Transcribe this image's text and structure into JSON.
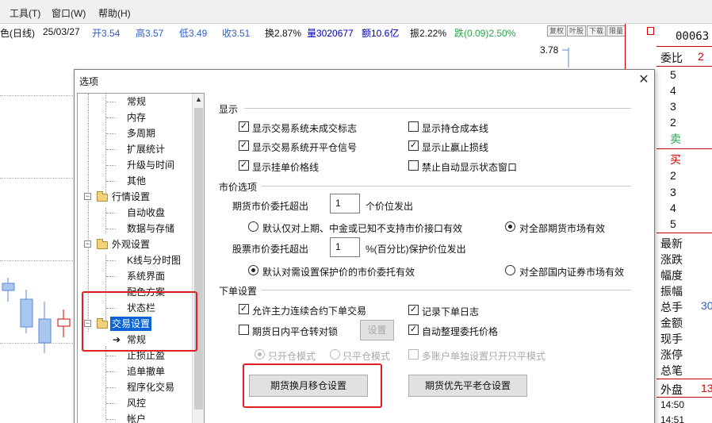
{
  "menubar": {
    "items": [
      "工具(T)",
      "窗口(W)",
      "帮助(H)"
    ]
  },
  "quote": {
    "prefix": "色(日线)",
    "date": "25/03/27",
    "open": "开3.54",
    "high": "高3.57",
    "low": "低3.49",
    "close": "收3.51",
    "turnover": "换2.87%",
    "volume": "量3020677",
    "amount": "额10.6亿",
    "amplitude": "振2.22%",
    "change": "跌(0.09)2.50%",
    "buttons": [
      "复权",
      "叶股",
      "下载",
      "限量"
    ]
  },
  "chart": {
    "price_label": "3.78"
  },
  "right_panel": {
    "code": "00063",
    "commission_label": "委比",
    "commission_value": "2",
    "sell_levels": [
      "5",
      "4",
      "3",
      "2"
    ],
    "sell_label": "卖",
    "buy_label": "买",
    "buy_levels": [
      "2",
      "3",
      "4",
      "5"
    ],
    "stats": [
      "最新",
      "涨跌",
      "幅度",
      "振幅",
      "总手",
      "金额",
      "现手",
      "涨停",
      "总笔"
    ],
    "total_hands_value": "30",
    "outer_label": "外盘",
    "outer_value": "13",
    "times": [
      "14:50",
      "14:51"
    ]
  },
  "dialog": {
    "title": "选项",
    "close_symbol": "✕",
    "tree": [
      {
        "label": "常规",
        "level": 2
      },
      {
        "label": "内存",
        "level": 2
      },
      {
        "label": "多周期",
        "level": 2
      },
      {
        "label": "扩展统计",
        "level": 2
      },
      {
        "label": "升级与时间",
        "level": 2
      },
      {
        "label": "其他",
        "level": 2
      },
      {
        "label": "行情设置",
        "level": 1
      },
      {
        "label": "自动收盘",
        "level": 2
      },
      {
        "label": "数据与存储",
        "level": 2
      },
      {
        "label": "外观设置",
        "level": 1
      },
      {
        "label": "K线与分时图",
        "level": 2
      },
      {
        "label": "系统界面",
        "level": 2
      },
      {
        "label": "配色方案",
        "level": 2
      },
      {
        "label": "状态栏",
        "level": 2
      },
      {
        "label": "交易设置",
        "level": 1,
        "selected": true
      },
      {
        "label": "常规",
        "level": 2,
        "arrow": true
      },
      {
        "label": "止损止盈",
        "level": 2
      },
      {
        "label": "追单撤单",
        "level": 2
      },
      {
        "label": "程序化交易",
        "level": 2
      },
      {
        "label": "风控",
        "level": 2
      },
      {
        "label": "帐户",
        "level": 2
      }
    ],
    "display": {
      "title": "显示",
      "left": [
        {
          "label": "显示交易系统未成交标志",
          "checked": true
        },
        {
          "label": "显示交易系统开平仓信号",
          "checked": true
        },
        {
          "label": "显示挂单价格线",
          "checked": true
        }
      ],
      "right": [
        {
          "label": "显示持仓成本线",
          "checked": false
        },
        {
          "label": "显示止赢止损线",
          "checked": true
        },
        {
          "label": "禁止自动显示状态窗口",
          "checked": false
        }
      ]
    },
    "market": {
      "title": "市价选项",
      "futures_label": "期货市价委托超出",
      "futures_value": "1",
      "futures_unit": "个价位发出",
      "futures_radio_a": "默认仅对上期、中金或已知不支持市价接口有效",
      "futures_radio_b": "对全部期货市场有效",
      "stock_label": "股票市价委托超出",
      "stock_value": "1",
      "stock_unit": "%(百分比)保护价位发出",
      "stock_radio_a": "默认对需设置保护价的市价委托有效",
      "stock_radio_b": "对全部国内证券市场有效"
    },
    "order": {
      "title": "下单设置",
      "allow_main": "允许主力连续合约下单交易",
      "allow_main_checked": true,
      "record_log": "记录下单日志",
      "record_log_checked": true,
      "intraday_lock": "期货日内平仓转对锁",
      "intraday_lock_checked": false,
      "settings_btn": "设置",
      "auto_tidy": "自动整理委托价格",
      "auto_tidy_checked": true,
      "only_open": "只开仓模式",
      "only_close": "只平仓模式",
      "multi_account": "多账户单独设置只开只平模式",
      "rollover_btn": "期货换月移仓设置",
      "close_old_btn": "期货优先平老仓设置"
    }
  }
}
